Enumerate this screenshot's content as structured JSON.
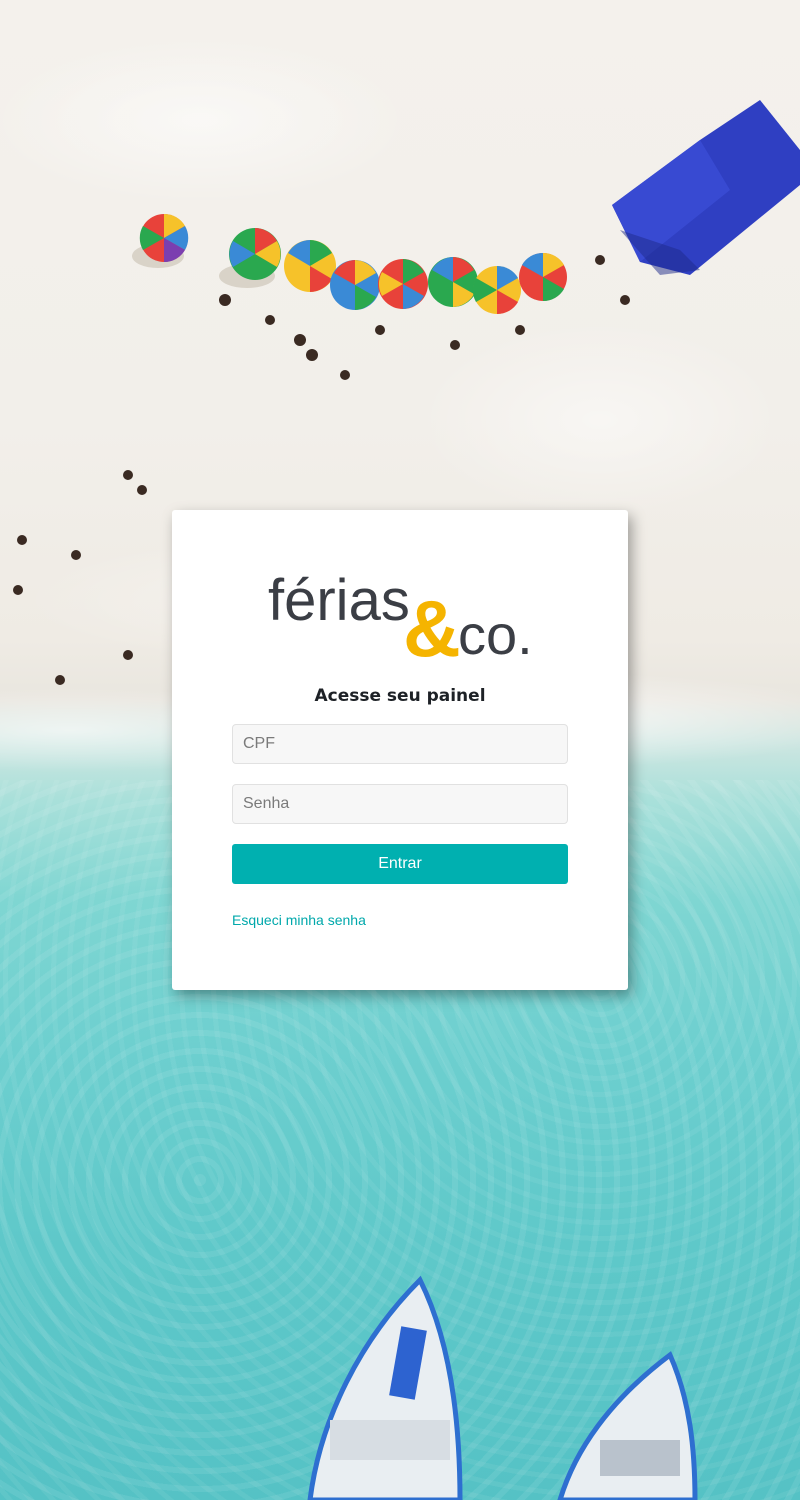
{
  "brand": {
    "logo_main": "férias",
    "logo_amp": "&",
    "logo_suffix": "co.",
    "logo_text_color": "#3b3e45",
    "logo_accent_color": "#f5b400"
  },
  "login": {
    "heading": "Acesse seu painel",
    "cpf_placeholder": "CPF",
    "cpf_value": "",
    "password_placeholder": "Senha",
    "password_value": "",
    "submit_label": "Entrar",
    "forgot_link": "Esqueci minha senha"
  },
  "colors": {
    "primary": "#00b0b0",
    "link": "#00a8ab",
    "card_background": "#ffffff"
  },
  "background": {
    "icon": "beach-aerial-photo"
  }
}
